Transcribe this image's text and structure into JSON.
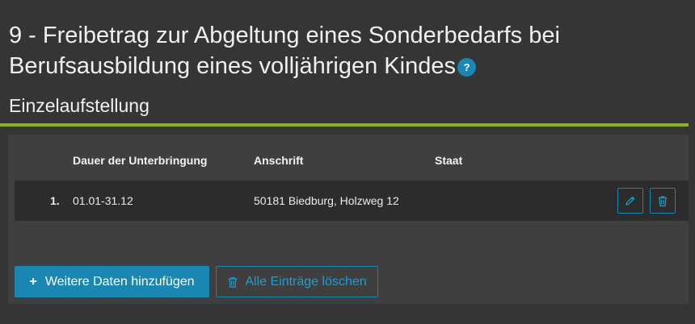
{
  "page": {
    "title": "9 - Freibetrag zur Abgeltung eines Sonderbedarfs bei Berufsausbildung eines volljährigen Kindes",
    "help_icon_glyph": "?"
  },
  "section": {
    "title": "Einzelaufstellung"
  },
  "table": {
    "columns": [
      "Dauer der Unterbringung",
      "Anschrift",
      "Staat"
    ],
    "rows": [
      {
        "number": "1.",
        "duration": "01.01-31.12",
        "address": "50181 Biedburg, Holzweg 12",
        "country": ""
      }
    ]
  },
  "actions": {
    "add_icon": "+",
    "add_label": "Weitere Daten hinzufügen",
    "delete_all_label": "Alle Einträge löschen"
  },
  "icons": {
    "help": "help-circle-icon",
    "edit": "pencil-icon",
    "delete": "trash-icon"
  },
  "colors": {
    "background": "#353535",
    "panel": "#3f3f3f",
    "row": "#2c2c2c",
    "accent_blue": "#1a87b3",
    "accent_green": "#8fb01d"
  }
}
